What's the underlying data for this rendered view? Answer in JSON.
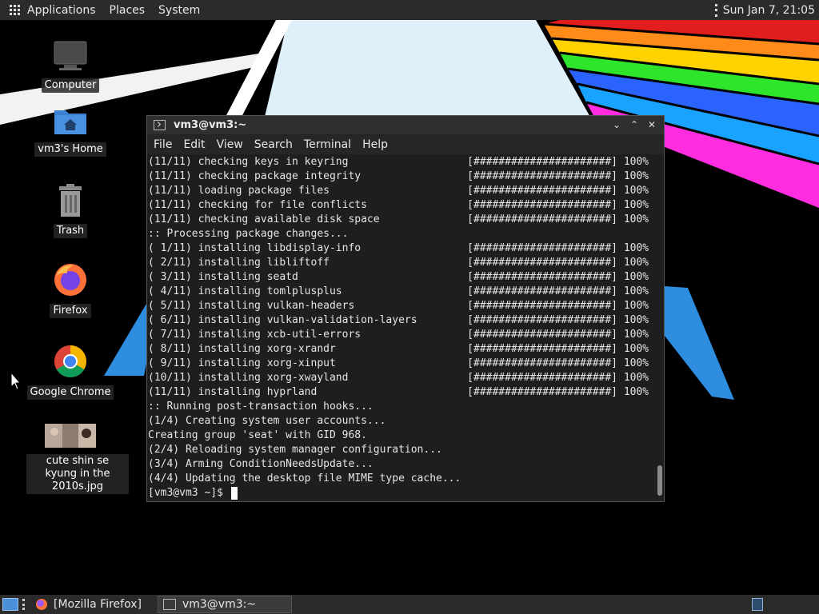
{
  "top_panel": {
    "menus": [
      "Applications",
      "Places",
      "System"
    ],
    "clock": "Sun Jan  7, 21:05"
  },
  "desktop_icons": [
    {
      "label": "Computer",
      "icon": "computer-icon"
    },
    {
      "label": "vm3's Home",
      "icon": "home-folder-icon"
    },
    {
      "label": "Trash",
      "icon": "trash-icon"
    },
    {
      "label": "Firefox",
      "icon": "firefox-icon"
    },
    {
      "label": "Google Chrome",
      "icon": "chrome-icon"
    },
    {
      "label": "cute shin se kyung in the 2010s.jpg",
      "icon": "image-thumbnail-icon"
    }
  ],
  "terminal": {
    "title": "vm3@vm3:~",
    "menus": [
      "File",
      "Edit",
      "View",
      "Search",
      "Terminal",
      "Help"
    ],
    "lines": [
      "(11/11) checking keys in keyring                   [######################] 100%",
      "(11/11) checking package integrity                 [######################] 100%",
      "(11/11) loading package files                      [######################] 100%",
      "(11/11) checking for file conflicts                [######################] 100%",
      "(11/11) checking available disk space              [######################] 100%",
      ":: Processing package changes...",
      "( 1/11) installing libdisplay-info                 [######################] 100%",
      "( 2/11) installing libliftoff                      [######################] 100%",
      "( 3/11) installing seatd                           [######################] 100%",
      "( 4/11) installing tomlplusplus                    [######################] 100%",
      "( 5/11) installing vulkan-headers                  [######################] 100%",
      "( 6/11) installing vulkan-validation-layers        [######################] 100%",
      "( 7/11) installing xcb-util-errors                 [######################] 100%",
      "( 8/11) installing xorg-xrandr                     [######################] 100%",
      "( 9/11) installing xorg-xinput                     [######################] 100%",
      "(10/11) installing xorg-xwayland                   [######################] 100%",
      "(11/11) installing hyprland                        [######################] 100%",
      ":: Running post-transaction hooks...",
      "(1/4) Creating system user accounts...",
      "Creating group 'seat' with GID 968.",
      "(2/4) Reloading system manager configuration...",
      "(3/4) Arming ConditionNeedsUpdate...",
      "(4/4) Updating the desktop file MIME type cache..."
    ],
    "prompt": "[vm3@vm3 ~]$ "
  },
  "taskbar": {
    "tasks": [
      {
        "label": "[Mozilla Firefox]",
        "icon": "firefox-icon"
      },
      {
        "label": "vm3@vm3:~",
        "icon": "terminal-icon"
      }
    ]
  },
  "colors": {
    "panel_bg": "#2b2b2b",
    "terminal_bg": "#1e1e1e",
    "terminal_fg": "#e6e6e6",
    "wallpaper_blue": "#2f8de0"
  }
}
